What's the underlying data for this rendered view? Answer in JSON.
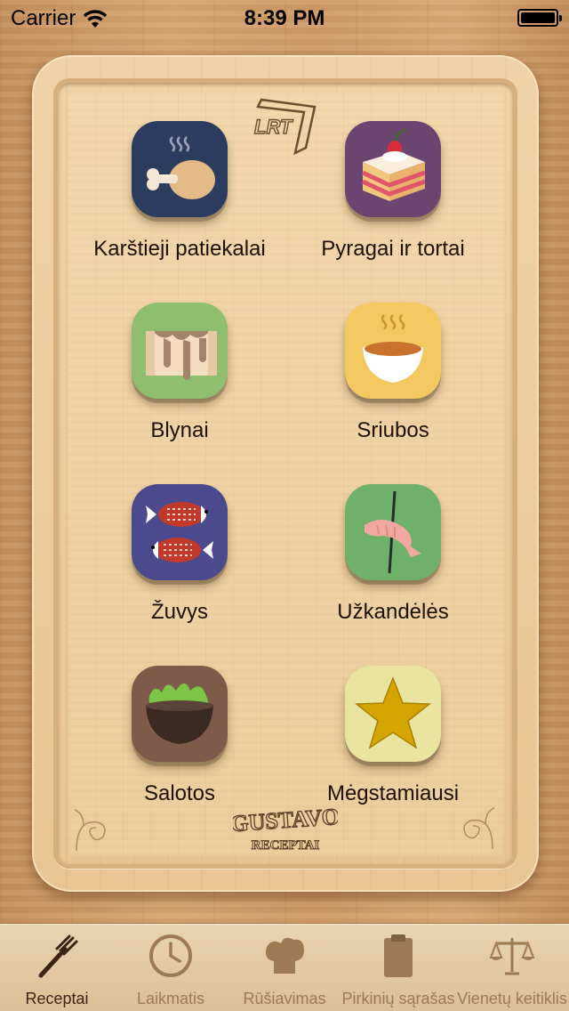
{
  "status_bar": {
    "carrier": "Carrier",
    "time": "8:39 PM"
  },
  "logos": {
    "top": "LRT",
    "bottom_line1": "GUSTAVO",
    "bottom_line2": "RECEPTAI"
  },
  "categories": [
    {
      "label": "Karštieji patiekalai",
      "icon": "chicken-leg-icon",
      "color": "#2c3c5f"
    },
    {
      "label": "Pyragai ir tortai",
      "icon": "cake-icon",
      "color": "#6a4570"
    },
    {
      "label": "Blynai",
      "icon": "pancake-icon",
      "color": "#8fbf6e"
    },
    {
      "label": "Sriubos",
      "icon": "soup-bowl-icon",
      "color": "#f3c861"
    },
    {
      "label": "Žuvys",
      "icon": "fish-icon",
      "color": "#4b4a8d"
    },
    {
      "label": "Užkandėlės",
      "icon": "shrimp-skewer-icon",
      "color": "#6fb06a"
    },
    {
      "label": "Salotos",
      "icon": "salad-bowl-icon",
      "color": "#7e5a4b"
    },
    {
      "label": "Mėgstamiausi",
      "icon": "star-icon",
      "color": "#e9e5a0"
    }
  ],
  "tabs": [
    {
      "label": "Receptai",
      "icon": "fork-icon",
      "active": true
    },
    {
      "label": "Laikmatis",
      "icon": "clock-icon",
      "active": false
    },
    {
      "label": "Rūšiavimas",
      "icon": "chef-hat-icon",
      "active": false
    },
    {
      "label": "Pirkinių sąrašas",
      "icon": "clipboard-icon",
      "active": false
    },
    {
      "label": "Vienetų keitiklis",
      "icon": "scales-icon",
      "active": false
    }
  ]
}
